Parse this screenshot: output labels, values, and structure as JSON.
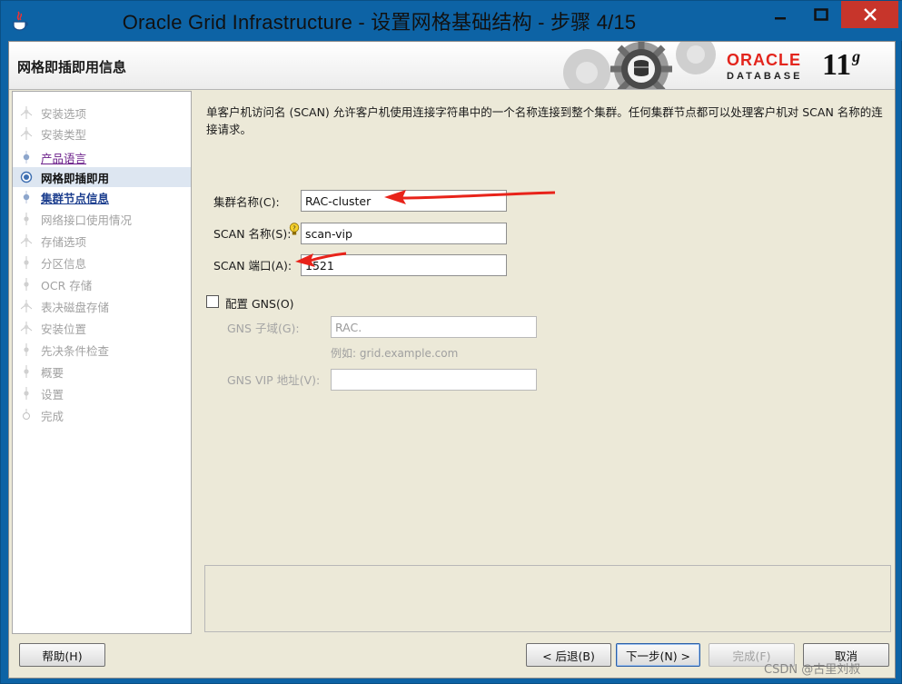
{
  "window": {
    "title": "Oracle Grid Infrastructure - 设置网格基础结构 - 步骤 4/15"
  },
  "header": {
    "page_heading": "网格即插即用信息",
    "brand_name": "ORACLE",
    "brand_product": "DATABASE",
    "version_major": "11",
    "version_suffix": "g"
  },
  "sidebar": {
    "steps": [
      {
        "label": "安装选项",
        "state": "disabled"
      },
      {
        "label": "安装类型",
        "state": "disabled"
      },
      {
        "label": "产品语言",
        "state": "done"
      },
      {
        "label": "网格即插即用",
        "state": "current"
      },
      {
        "label": "集群节点信息",
        "state": "link"
      },
      {
        "label": "网络接口使用情况",
        "state": "disabled"
      },
      {
        "label": "存储选项",
        "state": "disabled"
      },
      {
        "label": "分区信息",
        "state": "disabled"
      },
      {
        "label": "OCR 存储",
        "state": "disabled"
      },
      {
        "label": "表决磁盘存储",
        "state": "disabled"
      },
      {
        "label": "安装位置",
        "state": "disabled"
      },
      {
        "label": "先决条件检查",
        "state": "disabled"
      },
      {
        "label": "概要",
        "state": "disabled"
      },
      {
        "label": "设置",
        "state": "disabled"
      },
      {
        "label": "完成",
        "state": "disabled"
      }
    ]
  },
  "main": {
    "description": "单客户机访问名 (SCAN) 允许客户机使用连接字符串中的一个名称连接到整个集群。任何集群节点都可以处理客户机对 SCAN 名称的连接请求。",
    "cluster_name_label": "集群名称(C):",
    "cluster_name_value": "RAC-cluster",
    "scan_name_label": "SCAN 名称(S):",
    "scan_name_value": "scan-vip",
    "scan_port_label": "SCAN 端口(A):",
    "scan_port_value": "1521",
    "configure_gns_label": "配置 GNS(O)",
    "configure_gns_checked": false,
    "gns_subdomain_label": "GNS 子域(G):",
    "gns_subdomain_value": "RAC.",
    "gns_example": "例如: grid.example.com",
    "gns_vip_label": "GNS VIP 地址(V):",
    "gns_vip_value": ""
  },
  "footer": {
    "help_label": "帮助(H)",
    "back_label": "< 后退(B)",
    "next_label": "下一步(N) >",
    "finish_label": "完成(F)",
    "cancel_label": "取消"
  },
  "watermark": "CSDN @古里刘叔",
  "colors": {
    "titlebar": "#0d63a5",
    "close_button": "#c7352b",
    "annotation_arrow": "#e8231a",
    "oracle_red": "#e3251d"
  }
}
